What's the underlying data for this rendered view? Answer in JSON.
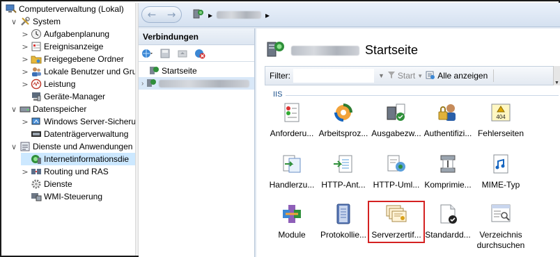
{
  "tree": {
    "items": [
      {
        "label": "Computerverwaltung (Lokal)",
        "icon": "computer-management-icon",
        "level": 0,
        "expander": ""
      },
      {
        "label": "System",
        "icon": "tools-icon",
        "level": 1,
        "expander": "∨"
      },
      {
        "label": "Aufgabenplanung",
        "icon": "clock-icon",
        "level": 2,
        "expander": ">"
      },
      {
        "label": "Ereignisanzeige",
        "icon": "event-viewer-icon",
        "level": 2,
        "expander": ">"
      },
      {
        "label": "Freigegebene Ordner",
        "icon": "shared-folder-icon",
        "level": 2,
        "expander": ">"
      },
      {
        "label": "Lokale Benutzer und Gru",
        "icon": "users-icon",
        "level": 2,
        "expander": ">"
      },
      {
        "label": "Leistung",
        "icon": "performance-icon",
        "level": 2,
        "expander": ">"
      },
      {
        "label": "Geräte-Manager",
        "icon": "device-manager-icon",
        "level": 2,
        "expander": ""
      },
      {
        "label": "Datenspeicher",
        "icon": "storage-icon",
        "level": 1,
        "expander": "∨"
      },
      {
        "label": "Windows Server-Sicheru",
        "icon": "backup-icon",
        "level": 2,
        "expander": ">"
      },
      {
        "label": "Datenträgerverwaltung",
        "icon": "disk-management-icon",
        "level": 2,
        "expander": ""
      },
      {
        "label": "Dienste und Anwendungen",
        "icon": "services-apps-icon",
        "level": 1,
        "expander": "∨"
      },
      {
        "label": "Internetinformationsdie",
        "icon": "iis-icon",
        "level": 2,
        "expander": "",
        "selected": true
      },
      {
        "label": "Routing und RAS",
        "icon": "routing-icon",
        "level": 2,
        "expander": ">"
      },
      {
        "label": "Dienste",
        "icon": "services-gear-icon",
        "level": 2,
        "expander": ""
      },
      {
        "label": "WMI-Steuerung",
        "icon": "wmi-icon",
        "level": 2,
        "expander": ""
      }
    ]
  },
  "iis": {
    "nav": {
      "back": "←",
      "forward": "→",
      "path_sep1": "▸",
      "path_sep2": "▸"
    },
    "connections": {
      "title": "Verbindungen",
      "start_node": "Startseite"
    },
    "home": {
      "title": "Startseite",
      "filter_label": "Filter:",
      "start_label": "Start",
      "show_all_label": "Alle anzeigen",
      "group": "IIS",
      "features": [
        {
          "label": "Anforderu...",
          "icon": "request-filtering-icon"
        },
        {
          "label": "Arbeitsproz...",
          "icon": "worker-processes-icon"
        },
        {
          "label": "Ausgabezw...",
          "icon": "output-caching-icon"
        },
        {
          "label": "Authentifizi...",
          "icon": "authentication-icon"
        },
        {
          "label": "Fehlerseiten",
          "icon": "error-pages-icon",
          "badge": "404"
        },
        {
          "label": "Handlerzu...",
          "icon": "handler-mappings-icon"
        },
        {
          "label": "HTTP-Ant...",
          "icon": "http-response-headers-icon"
        },
        {
          "label": "HTTP-Uml...",
          "icon": "http-redirect-icon"
        },
        {
          "label": "Komprimie...",
          "icon": "compression-icon"
        },
        {
          "label": "MIME-Typ",
          "icon": "mime-types-icon"
        },
        {
          "label": "Module",
          "icon": "modules-icon"
        },
        {
          "label": "Protokollie...",
          "icon": "logging-icon"
        },
        {
          "label": "Serverzertif...",
          "icon": "server-certificates-icon",
          "highlight": true
        },
        {
          "label": "Standardd...",
          "icon": "default-document-icon"
        },
        {
          "label": "Verzeichnis durchsuchen",
          "icon": "directory-browsing-icon"
        }
      ]
    }
  },
  "colors": {
    "selection": "#cce8ff",
    "highlight_border": "#d42121",
    "iis_chrome": "#dfe7f1",
    "group_label": "#1a4f8b"
  }
}
